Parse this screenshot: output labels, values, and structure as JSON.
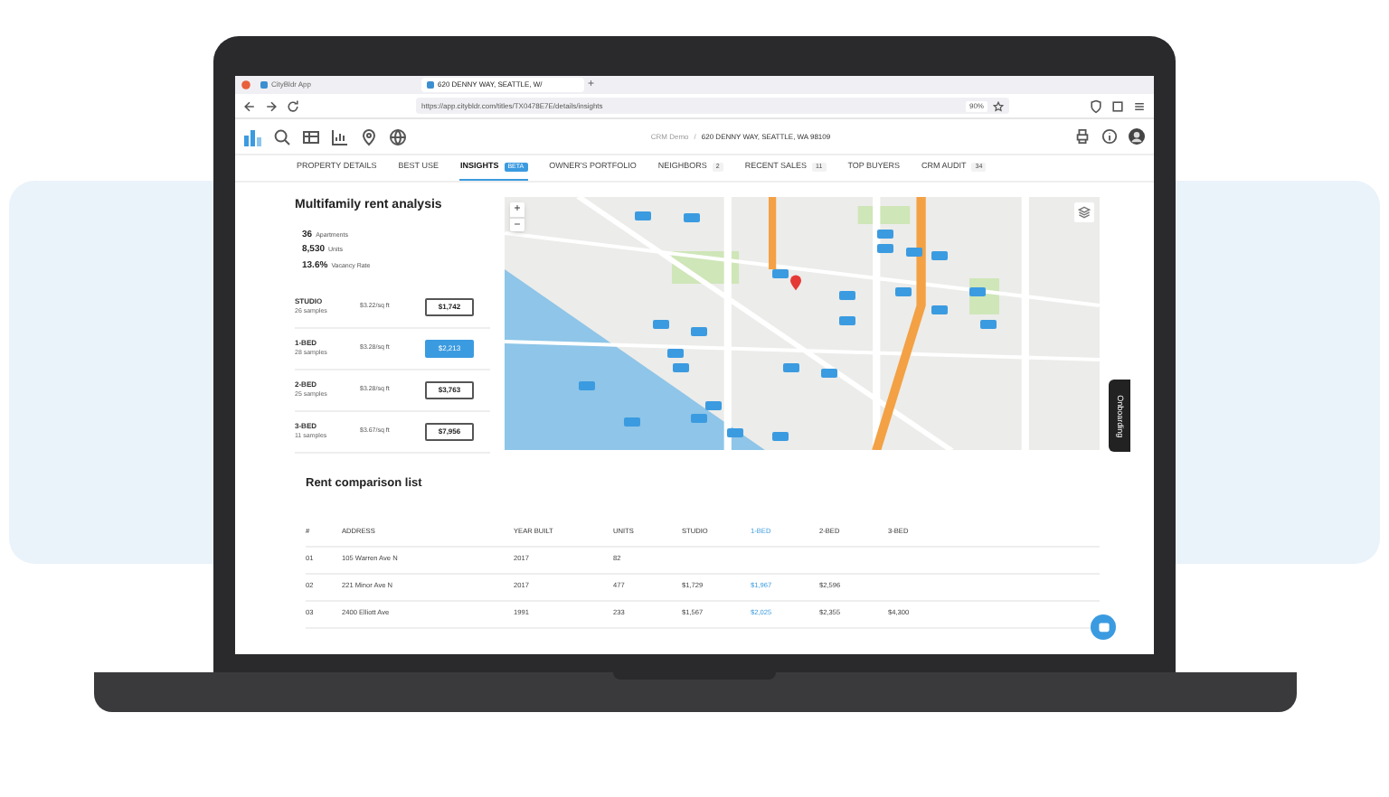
{
  "browser": {
    "tabs": [
      {
        "title": "CityBldr App",
        "selected": false
      },
      {
        "title": "620 DENNY WAY, SEATTLE, W/",
        "selected": true
      }
    ],
    "new_tab": "+",
    "url": "https://app.citybldr.com/titles/TX0478E7E/details/insights",
    "zoom": "90%"
  },
  "app_toolbar": {
    "breadcrumb": [
      "CRM Demo",
      "620 DENNY WAY, SEATTLE, WA 98109"
    ],
    "separator": "/"
  },
  "nav_tabs": [
    {
      "label": "PROPERTY DETAILS",
      "selected": false
    },
    {
      "label": "BEST USE",
      "selected": false
    },
    {
      "label": "INSIGHTS",
      "badge": "BETA",
      "selected": true
    },
    {
      "label": "OWNER'S PORTFOLIO",
      "selected": false
    },
    {
      "label": "NEIGHBORS",
      "badge": "2",
      "selected": false
    },
    {
      "label": "RECENT SALES",
      "badge": "11",
      "selected": false
    },
    {
      "label": "TOP BUYERS",
      "selected": false
    },
    {
      "label": "CRM AUDIT",
      "badge": "34",
      "selected": false
    }
  ],
  "analysis": {
    "title": "Multifamily rent analysis",
    "stats": [
      {
        "value": "36",
        "label": "Apartments"
      },
      {
        "value": "8,530",
        "label": "Units"
      },
      {
        "value": "13.6%",
        "label": "Vacancy Rate"
      }
    ],
    "rows": [
      {
        "type": "STUDIO",
        "samples": "26 samples",
        "per_sqft": "$3.22/sq ft",
        "rent": "$1,742",
        "selected": false
      },
      {
        "type": "1-BED",
        "samples": "28 samples",
        "per_sqft": "$3.28/sq ft",
        "rent": "$2,213",
        "selected": true
      },
      {
        "type": "2-BED",
        "samples": "25 samples",
        "per_sqft": "$3.28/sq ft",
        "rent": "$3,763",
        "selected": false
      },
      {
        "type": "3-BED",
        "samples": "11 samples",
        "per_sqft": "$3.67/sq ft",
        "rent": "$7,956",
        "selected": false
      }
    ]
  },
  "map": {
    "zoom_in": "+",
    "zoom_out": "−"
  },
  "table": {
    "title": "Rent comparison list",
    "columns": [
      {
        "label": "#",
        "highlighted": false
      },
      {
        "label": "ADDRESS",
        "highlighted": false
      },
      {
        "label": "YEAR BUILT",
        "highlighted": false
      },
      {
        "label": "UNITS",
        "highlighted": false
      },
      {
        "label": "STUDIO",
        "highlighted": false
      },
      {
        "label": "1-BED",
        "highlighted": true
      },
      {
        "label": "2-BED",
        "highlighted": false
      },
      {
        "label": "3-BED",
        "highlighted": false
      }
    ],
    "rows": [
      [
        "01",
        "105 Warren Ave N",
        "2017",
        "82",
        "",
        "",
        "",
        ""
      ],
      [
        "02",
        "221 Minor Ave N",
        "2017",
        "477",
        "$1,729",
        "$1,967",
        "$2,596",
        ""
      ],
      [
        "03",
        "2400 Elliott Ave",
        "1991",
        "233",
        "$1,567",
        "$2,025",
        "$2,355",
        "$4,300"
      ]
    ]
  },
  "onboarding": "Onboarding"
}
